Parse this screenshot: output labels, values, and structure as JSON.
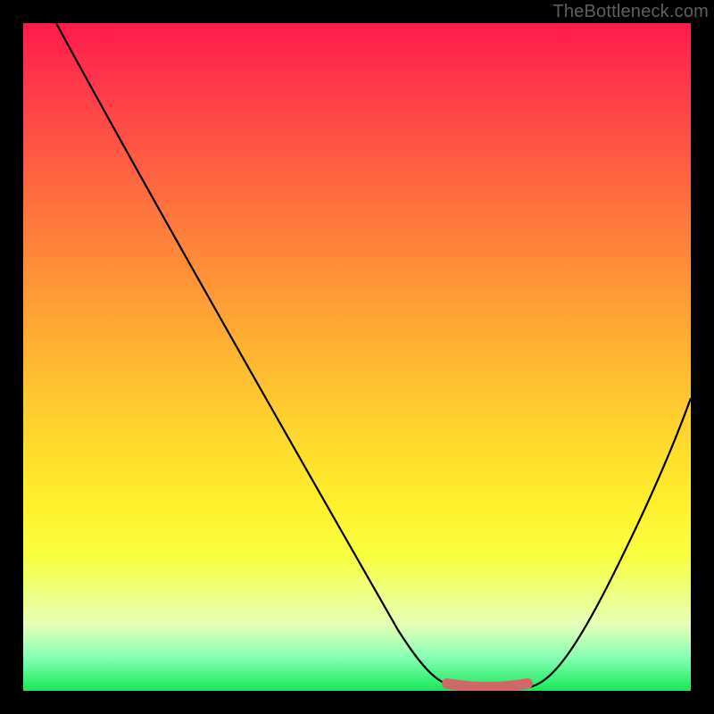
{
  "attribution": "TheBottleneck.com",
  "colors": {
    "background": "#000000",
    "curve": "#000000",
    "marker": "#d16868",
    "gradient_top": "#ff1a4d",
    "gradient_bottom": "#18e858"
  },
  "chart_data": {
    "type": "line",
    "title": "",
    "xlabel": "",
    "ylabel": "",
    "xlim": [
      0,
      100
    ],
    "ylim": [
      0,
      100
    ],
    "grid": false,
    "series": [
      {
        "name": "bottleneck-curve",
        "x": [
          5,
          10,
          15,
          20,
          25,
          30,
          35,
          40,
          45,
          50,
          55,
          60,
          63,
          66,
          70,
          73,
          76,
          80,
          84,
          88,
          92,
          96,
          100
        ],
        "values": [
          100,
          92,
          84,
          76,
          68,
          60,
          52,
          44,
          36,
          28,
          20,
          12,
          6,
          2,
          0,
          0,
          0,
          2,
          8,
          18,
          30,
          42,
          55
        ]
      }
    ],
    "annotations": [
      {
        "name": "optimal-range-marker",
        "x_range": [
          63,
          76
        ],
        "y": 0,
        "color": "#d16868"
      }
    ]
  }
}
